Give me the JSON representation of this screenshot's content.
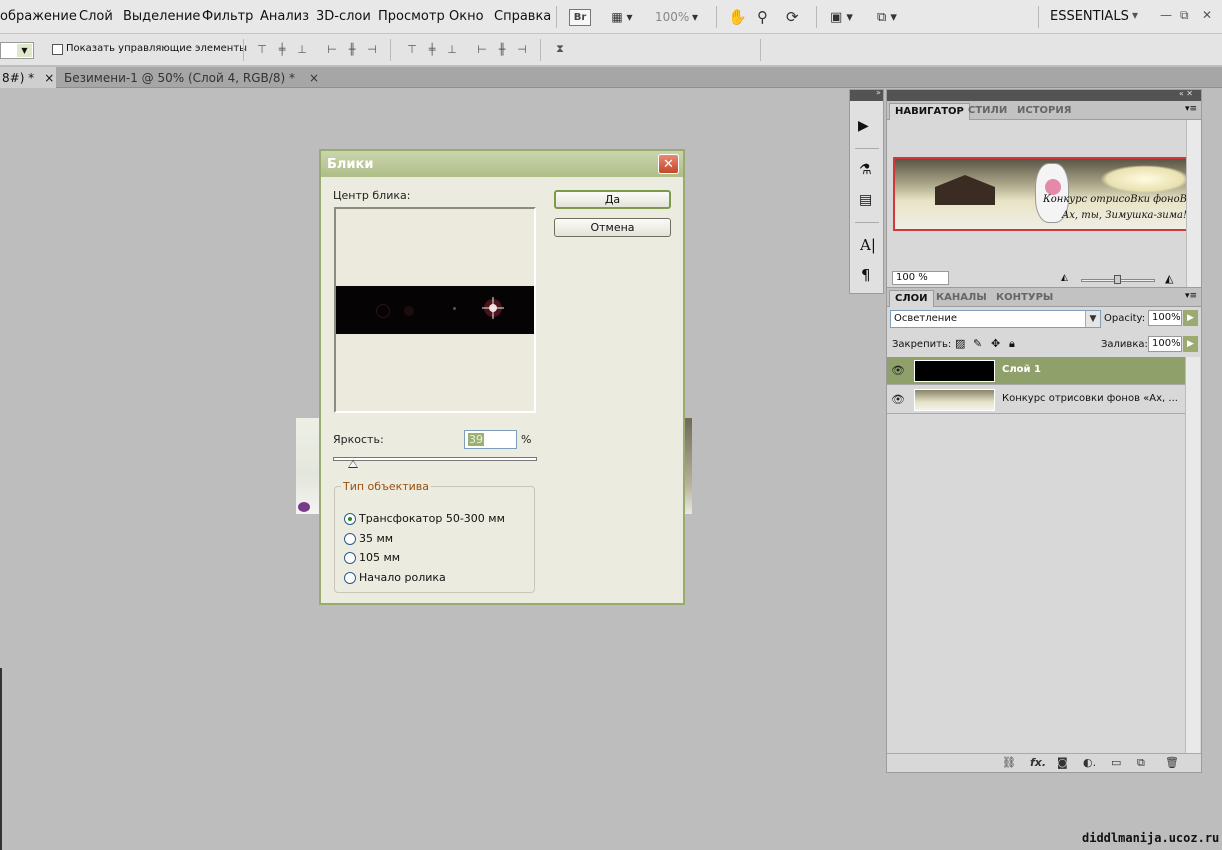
{
  "menu": {
    "items": [
      "ображение",
      "Слой",
      "Выделение",
      "Фильтр",
      "Анализ",
      "3D-слои",
      "Просмотр",
      "Окно",
      "Справка"
    ],
    "br_label": "Br",
    "zoom": "100%",
    "workspace": "ESSENTIALS"
  },
  "options_bar": {
    "show_controls_label": "Показать управляющие элементы"
  },
  "tabs": {
    "tab1": "8#) *",
    "tab2": "Безимени-1 @ 50% (Слой 4, RGB/8) *",
    "close": "×"
  },
  "dialog": {
    "title": "Блики",
    "close": "✕",
    "center_label": "Центр блика:",
    "ok_label": "Да",
    "cancel_label": "Отмена",
    "brightness_label": "Яркость:",
    "brightness_value": "39",
    "brightness_percent": 0.1,
    "percent_sign": "%",
    "lens_group_label": "Тип объектива",
    "lens_options": [
      "Трансфокатор 50-300 мм",
      "35 мм",
      "105 мм",
      "Начало ролика"
    ],
    "selected_lens_index": 0
  },
  "navigator": {
    "tabs": [
      "НАВИГАТОР",
      "СТИЛИ",
      "ИСТОРИЯ"
    ],
    "zoom_value": "100 %",
    "thumb_text_line1": "Конкурс отрисоВки фоноВ",
    "thumb_text_line2": "Ах, ты, Зимушка-зима!"
  },
  "layers": {
    "tabs": [
      "СЛОИ",
      "КАНАЛЫ",
      "КОНТУРЫ"
    ],
    "blend_mode": "Осветление",
    "opacity_label": "Opacity:",
    "opacity_value": "100%",
    "lock_label": "Закрепить:",
    "fill_label": "Заливка:",
    "fill_value": "100%",
    "rows": [
      {
        "name": "Слой 1",
        "selected": true
      },
      {
        "name": "Конкурс отрисовки фонов «Ах, ...",
        "selected": false
      }
    ]
  },
  "watermark": "diddlmanija.ucoz.ru",
  "colors": {
    "dialog_border": "#9aab72",
    "dialog_bg": "#ecebdf",
    "layer_selected": "#90a06a",
    "close_red": "#c3462c"
  }
}
